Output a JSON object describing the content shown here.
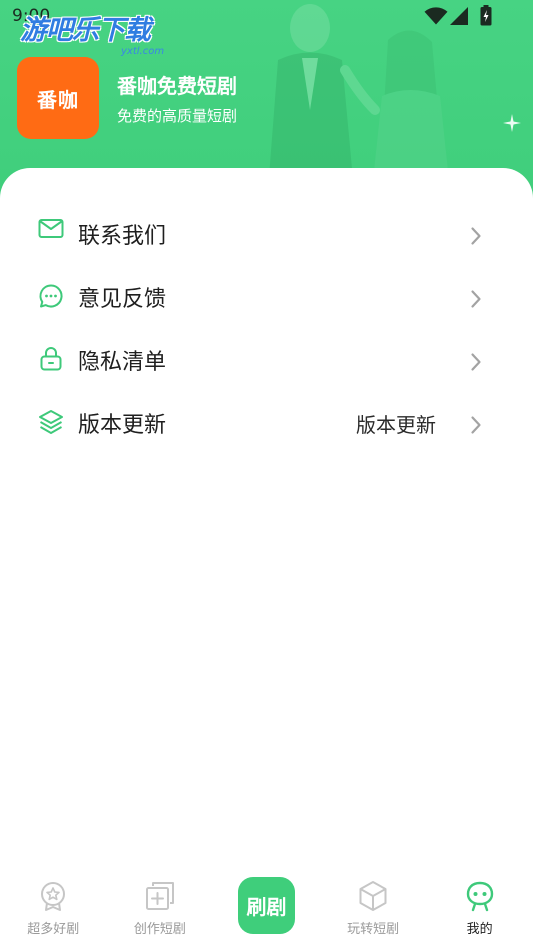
{
  "status_bar": {
    "time": "9:00",
    "icons": [
      "wifi-icon",
      "signal-icon",
      "battery-icon"
    ]
  },
  "watermark": {
    "title": "游吧乐下载",
    "domain": "yxtl.com"
  },
  "profile": {
    "logo_text": "番咖",
    "app_name": "番咖免费短剧",
    "tagline": "免费的高质量短剧"
  },
  "menu": {
    "items": [
      {
        "label": "联系我们",
        "icon": "mail-icon"
      },
      {
        "label": "意见反馈",
        "icon": "chat-icon"
      },
      {
        "label": "隐私清单",
        "icon": "lock-icon"
      },
      {
        "label": "版本更新",
        "icon": "layers-icon",
        "value": "版本更新"
      }
    ]
  },
  "bottom_nav": {
    "items": [
      {
        "label": "超多好剧",
        "icon": "star-badge-icon",
        "active": false
      },
      {
        "label": "创作短剧",
        "icon": "add-square-icon",
        "active": false
      },
      {
        "label": "刷剧",
        "active": false
      },
      {
        "label": "玩转短剧",
        "icon": "cube-icon",
        "active": false
      },
      {
        "label": "我的",
        "icon": "person-icon",
        "active": true
      }
    ]
  },
  "colors": {
    "accent": "#3fce7b",
    "logo_bg": "#ff6b14",
    "watermark": "#2f7de1",
    "inactive": "#9a9a9a"
  }
}
